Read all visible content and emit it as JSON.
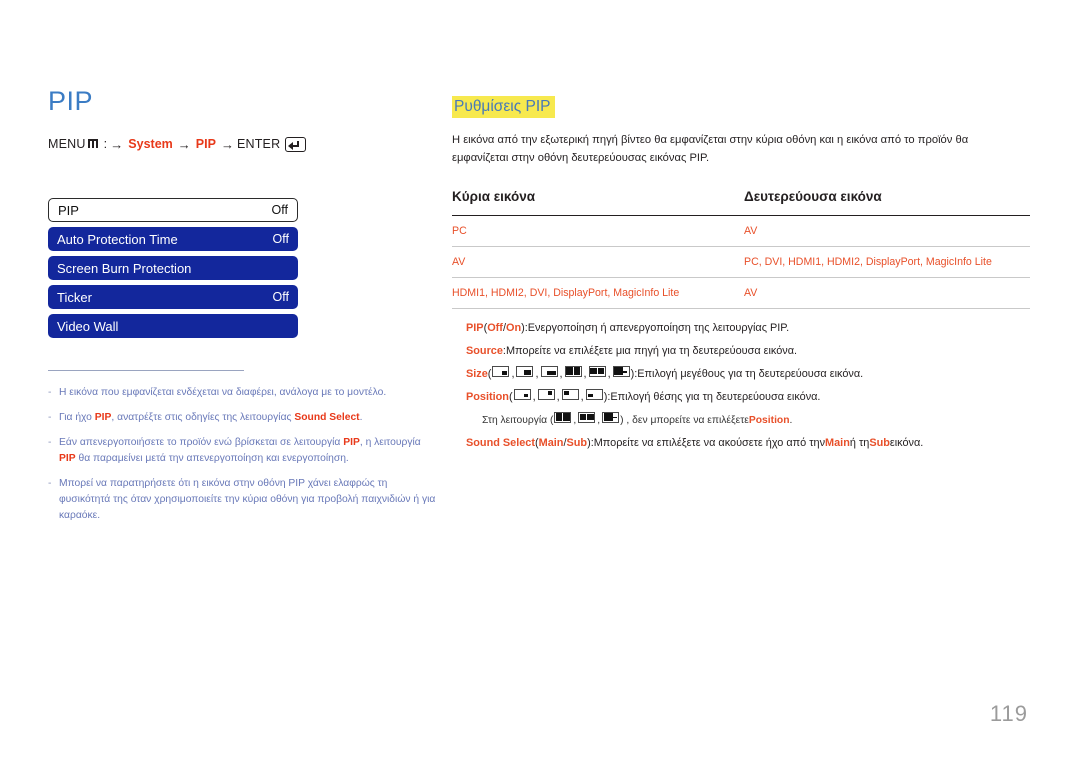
{
  "page": {
    "title": "PIP",
    "number": "119",
    "accent_title_color": "#3b7cc4",
    "accent_red": "#e8502a",
    "menu_blue": "#13279c",
    "highlight_yellow": "#f7e94e"
  },
  "breadcrumb": {
    "menu_label": "MENU",
    "menu_icon": "menu-keypad-icon",
    "colon": ":",
    "arrow": "→",
    "step1": "System",
    "step2": "PIP",
    "enter_label": "ENTER",
    "enter_icon": "enter-return-icon"
  },
  "osd_menu": {
    "rows": [
      {
        "label": "PIP",
        "value": "Off",
        "selected": true
      },
      {
        "label": "Auto Protection Time",
        "value": "Off",
        "selected": false
      },
      {
        "label": "Screen Burn Protection",
        "value": "",
        "selected": false
      },
      {
        "label": "Ticker",
        "value": "Off",
        "selected": false
      },
      {
        "label": "Video Wall",
        "value": "",
        "selected": false
      }
    ]
  },
  "notes": [
    {
      "dash": "-",
      "parts": [
        {
          "t": "Η εικόνα που εμφανίζεται ενδέχεται να διαφέρει, ανάλογα με το μοντέλο.",
          "hl": false
        }
      ]
    },
    {
      "dash": "-",
      "parts": [
        {
          "t": "Για ήχο ",
          "hl": false
        },
        {
          "t": "PIP",
          "hl": true
        },
        {
          "t": ", ανατρέξτε στις οδηγίες της λειτουργίας ",
          "hl": false
        },
        {
          "t": "Sound Select",
          "hl": true
        },
        {
          "t": ".",
          "hl": false
        }
      ]
    },
    {
      "dash": "-",
      "parts": [
        {
          "t": "Εάν απενεργοποιήσετε το προϊόν ενώ βρίσκεται σε λειτουργία ",
          "hl": false
        },
        {
          "t": "PIP",
          "hl": true
        },
        {
          "t": ", η λειτουργία ",
          "hl": false
        },
        {
          "t": "PIP",
          "hl": true
        },
        {
          "t": " θα παραμείνει μετά την απενεργοποίηση και ενεργοποίηση.",
          "hl": false
        }
      ]
    },
    {
      "dash": "-",
      "parts": [
        {
          "t": "Μπορεί να παρατηρήσετε ότι η εικόνα στην οθόνη PIP χάνει ελαφρώς τη φυσικότητά της όταν χρησιμοποιείτε την κύρια οθόνη για προβολή παιχνιδιών ή για καραόκε.",
          "hl": false
        }
      ]
    }
  ],
  "section": {
    "title": "Ρυθμίσεις PIP",
    "description": "Η εικόνα από την εξωτερική πηγή βίντεο θα εμφανίζεται στην κύρια οθόνη και η εικόνα από το προϊόν θα εμφανίζεται στην οθόνη δευτερεύουσας εικόνας PIP."
  },
  "table": {
    "headers": [
      "Κύρια εικόνα",
      "Δευτερεύουσα εικόνα"
    ],
    "rows": [
      {
        "main": "PC",
        "sub": "AV"
      },
      {
        "main": "AV",
        "sub": "PC, DVI, HDMI1, HDMI2, DisplayPort, MagicInfo Lite"
      },
      {
        "main": "HDMI1, HDMI2, DVI, DisplayPort, MagicInfo Lite",
        "sub": "AV"
      }
    ]
  },
  "specs": {
    "pip": {
      "name": "PIP",
      "open_paren": " (",
      "opt_off": "Off",
      "slash": " / ",
      "opt_on": "On",
      "close_paren": "): ",
      "desc": "Ενεργοποίηση ή απενεργοποίηση της λειτουργίας PIP."
    },
    "source": {
      "name": "Source",
      "colon": ": ",
      "desc": "Μπορείτε να επιλέξετε μια πηγή για τη δευτερεύουσα εικόνα."
    },
    "size": {
      "name": "Size",
      "open_paren": " (",
      "close_paren": "): ",
      "icons": [
        "pip-size-small-icon",
        "pip-size-medium-icon",
        "pip-size-large-icon",
        "pip-size-split-icon",
        "pip-size-split-wide-icon",
        "pip-size-pbp-icon"
      ],
      "desc": "Επιλογή μεγέθους για τη δευτερεύουσα εικόνα."
    },
    "position": {
      "name": "Position",
      "open_paren": " (",
      "close_paren": "): ",
      "icons": [
        "pip-position-bottom-right-icon",
        "pip-position-top-right-icon",
        "pip-position-top-left-icon",
        "pip-position-bottom-left-icon"
      ],
      "desc": "Επιλογή θέσης για τη δευτερεύουσα εικόνα."
    },
    "position_note": {
      "prefix": "Στη λειτουργία (",
      "icons": [
        "pip-size-split-icon",
        "pip-size-split-wide-icon",
        "pip-size-pbp-icon"
      ],
      "middle": ") , δεν μπορείτε να επιλέξετε ",
      "name": "Position",
      "suffix": "."
    },
    "sound_select": {
      "name": "Sound Select",
      "open_paren": " (",
      "opt_main": "Main",
      "slash": " / ",
      "opt_sub": "Sub",
      "close_paren": "): ",
      "desc_a": "Μπορείτε να επιλέξετε να ακούσετε ήχο από την ",
      "ref_main": "Main",
      "desc_b": " ή τη ",
      "ref_sub": "Sub",
      "desc_c": " εικόνα."
    }
  }
}
